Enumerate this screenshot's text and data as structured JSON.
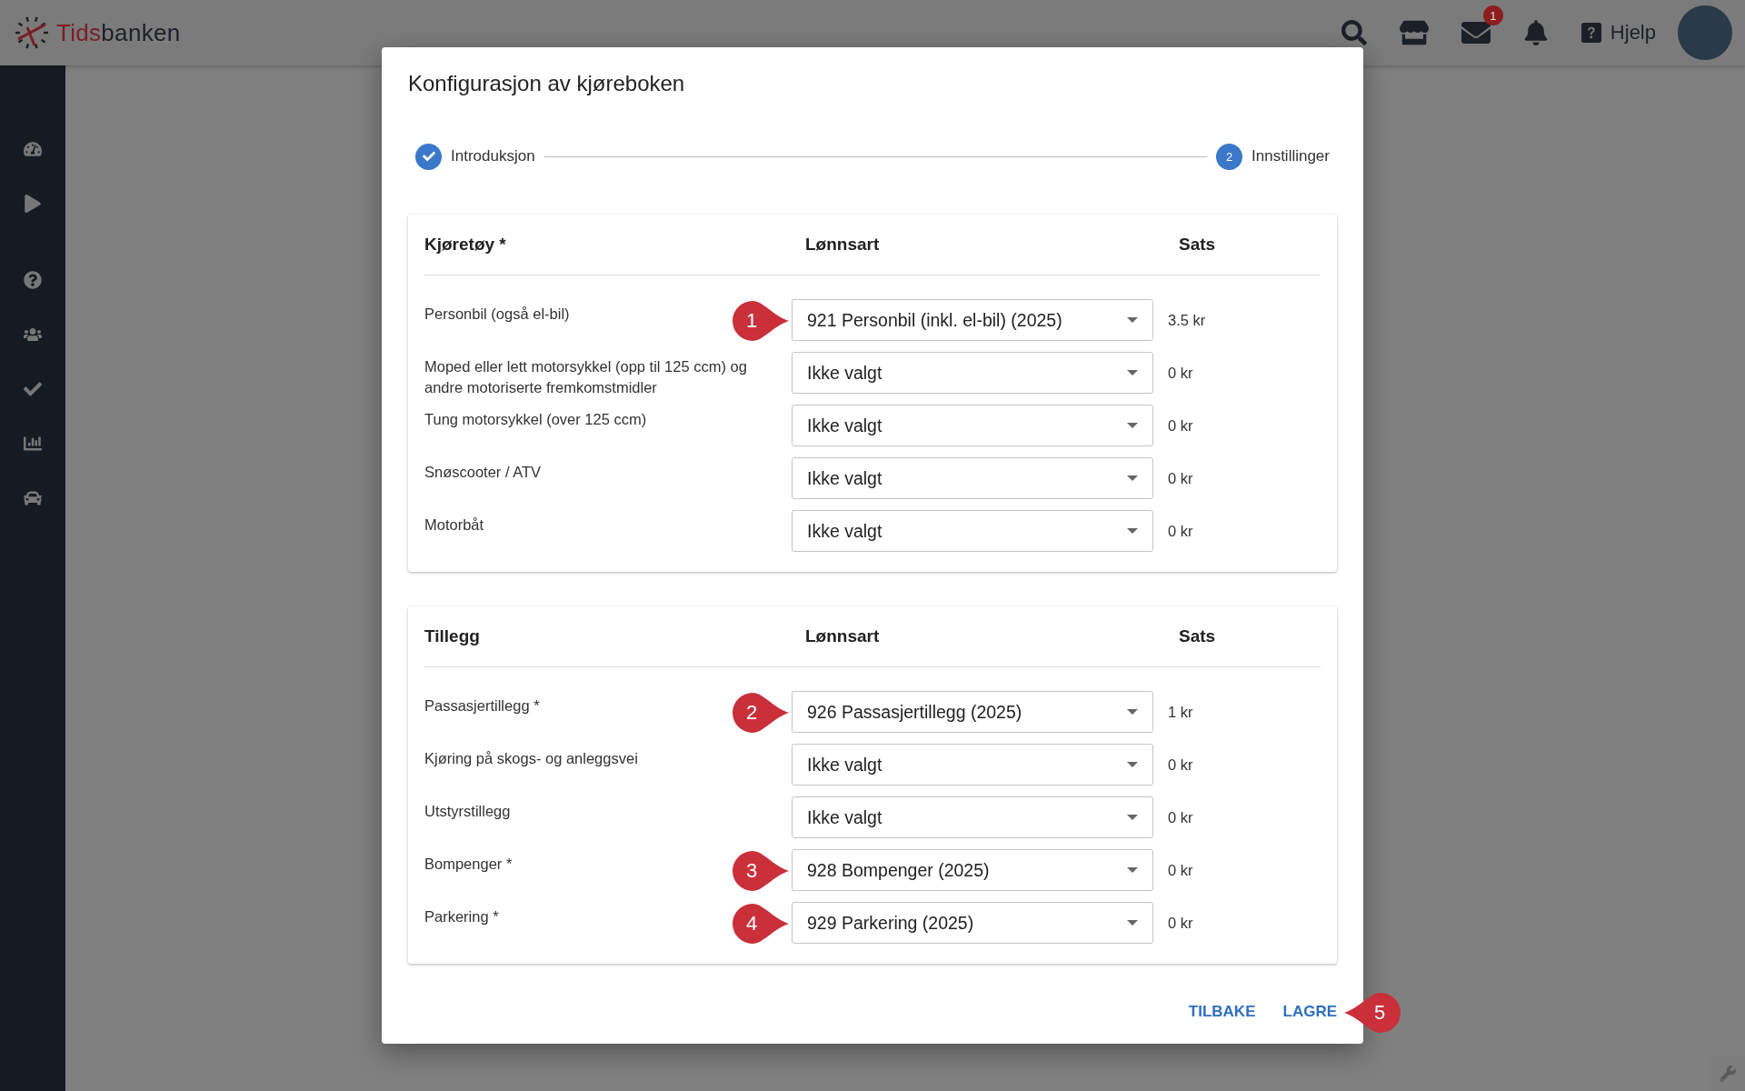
{
  "app_bar": {
    "logo_parts": [
      "Tids",
      "banken"
    ],
    "mail_badge": "1",
    "help_label": "Hjelp"
  },
  "dialog": {
    "title": "Konfigurasjon av kjøreboken",
    "steps": [
      {
        "label": "Introduksjon",
        "completed": true
      },
      {
        "label": "Innstillinger",
        "completed": false,
        "number": "2"
      }
    ],
    "sections": [
      {
        "heading": "Kjøretøy *",
        "columns": [
          "Lønnsart",
          "Sats"
        ],
        "rows": [
          {
            "label": "Personbil (også el-bil)",
            "value": "921 Personbil (inkl. el-bil) (2025)",
            "rate": "3.5 kr",
            "callout": "1"
          },
          {
            "label": "Moped eller lett motorsykkel (opp til 125 ccm) og andre motoriserte fremkomstmidler",
            "value": "Ikke valgt",
            "rate": "0 kr"
          },
          {
            "label": "Tung motorsykkel (over 125 ccm)",
            "value": "Ikke valgt",
            "rate": "0 kr"
          },
          {
            "label": "Snøscooter / ATV",
            "value": "Ikke valgt",
            "rate": "0 kr"
          },
          {
            "label": "Motorbåt",
            "value": "Ikke valgt",
            "rate": "0 kr"
          }
        ]
      },
      {
        "heading": "Tillegg",
        "columns": [
          "Lønnsart",
          "Sats"
        ],
        "rows": [
          {
            "label": "Passasjertillegg *",
            "value": "926 Passasjertillegg (2025)",
            "rate": "1 kr",
            "callout": "2"
          },
          {
            "label": "Kjøring på skogs- og anleggsvei",
            "value": "Ikke valgt",
            "rate": "0 kr"
          },
          {
            "label": "Utstyrstillegg",
            "value": "Ikke valgt",
            "rate": "0 kr"
          },
          {
            "label": "Bompenger *",
            "value": "928 Bompenger (2025)",
            "rate": "0 kr",
            "callout": "3"
          },
          {
            "label": "Parkering *",
            "value": "929 Parkering (2025)",
            "rate": "0 kr",
            "callout": "4"
          }
        ]
      }
    ],
    "buttons": [
      {
        "label": "TILBAKE"
      },
      {
        "label": "LAGRE",
        "callout": "5"
      }
    ]
  }
}
